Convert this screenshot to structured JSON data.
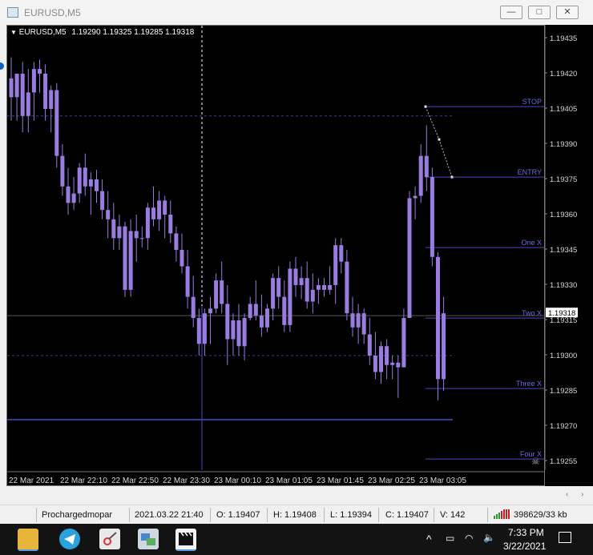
{
  "window": {
    "title": "EURUSD,M5",
    "buttons": {
      "minimize": "—",
      "maximize": "□",
      "close": "✕"
    }
  },
  "chart": {
    "header_symbol": "EURUSD,M5",
    "header_ohlc": "1.19290 1.19325 1.19285 1.19318",
    "price_ticks": [
      "1.19435",
      "1.19420",
      "1.19405",
      "1.19390",
      "1.19375",
      "1.19360",
      "1.19345",
      "1.19330",
      "1.19315",
      "1.19300",
      "1.19285",
      "1.19270",
      "1.19255"
    ],
    "current_price": "1.19318",
    "time_ticks": [
      "22 Mar 2021",
      "22 Mar 22:10",
      "22 Mar 22:50",
      "22 Mar 23:30",
      "23 Mar 00:10",
      "23 Mar 01:05",
      "23 Mar 01:45",
      "23 Mar 02:25",
      "23 Mar 03:05"
    ],
    "levels": [
      {
        "label": "STOP",
        "price": 1.19406
      },
      {
        "label": "ENTRY",
        "price": 1.19376
      },
      {
        "label": "One X",
        "price": 1.19346
      },
      {
        "label": "Two X",
        "price": 1.19316
      },
      {
        "label": "Three X",
        "price": 1.19286
      },
      {
        "label": "Four X",
        "price": 1.19256
      }
    ],
    "candles": [
      {
        "o": 1.19418,
        "h": 1.19427,
        "l": 1.194,
        "c": 1.1941
      },
      {
        "o": 1.1941,
        "h": 1.19418,
        "l": 1.194,
        "c": 1.1942
      },
      {
        "o": 1.1942,
        "h": 1.19425,
        "l": 1.19395,
        "c": 1.19402
      },
      {
        "o": 1.19402,
        "h": 1.19422,
        "l": 1.19395,
        "c": 1.19412
      },
      {
        "o": 1.19412,
        "h": 1.19425,
        "l": 1.194,
        "c": 1.19422
      },
      {
        "o": 1.19422,
        "h": 1.19426,
        "l": 1.19412,
        "c": 1.1942
      },
      {
        "o": 1.1942,
        "h": 1.19424,
        "l": 1.194,
        "c": 1.19405
      },
      {
        "o": 1.19405,
        "h": 1.19415,
        "l": 1.19395,
        "c": 1.19413
      },
      {
        "o": 1.19413,
        "h": 1.19416,
        "l": 1.1938,
        "c": 1.19385
      },
      {
        "o": 1.19385,
        "h": 1.1939,
        "l": 1.19368,
        "c": 1.19372
      },
      {
        "o": 1.19372,
        "h": 1.1938,
        "l": 1.1936,
        "c": 1.19365
      },
      {
        "o": 1.19365,
        "h": 1.19376,
        "l": 1.19362,
        "c": 1.19369
      },
      {
        "o": 1.19369,
        "h": 1.19382,
        "l": 1.19365,
        "c": 1.1938
      },
      {
        "o": 1.1938,
        "h": 1.19386,
        "l": 1.19368,
        "c": 1.19372
      },
      {
        "o": 1.19372,
        "h": 1.19378,
        "l": 1.1936,
        "c": 1.19375
      },
      {
        "o": 1.19375,
        "h": 1.19379,
        "l": 1.19365,
        "c": 1.1937
      },
      {
        "o": 1.1937,
        "h": 1.19375,
        "l": 1.19358,
        "c": 1.19362
      },
      {
        "o": 1.19362,
        "h": 1.1937,
        "l": 1.1935,
        "c": 1.19358
      },
      {
        "o": 1.19358,
        "h": 1.19365,
        "l": 1.19345,
        "c": 1.1935
      },
      {
        "o": 1.1935,
        "h": 1.1936,
        "l": 1.19345,
        "c": 1.19355
      },
      {
        "o": 1.19355,
        "h": 1.19357,
        "l": 1.19325,
        "c": 1.19328
      },
      {
        "o": 1.19328,
        "h": 1.19358,
        "l": 1.19325,
        "c": 1.19353
      },
      {
        "o": 1.19353,
        "h": 1.1936,
        "l": 1.1934,
        "c": 1.1935
      },
      {
        "o": 1.1935,
        "h": 1.19355,
        "l": 1.19346,
        "c": 1.1935
      },
      {
        "o": 1.1935,
        "h": 1.19365,
        "l": 1.19345,
        "c": 1.19363
      },
      {
        "o": 1.19363,
        "h": 1.19372,
        "l": 1.19355,
        "c": 1.19358
      },
      {
        "o": 1.19358,
        "h": 1.1937,
        "l": 1.19353,
        "c": 1.19366
      },
      {
        "o": 1.19366,
        "h": 1.19368,
        "l": 1.1935,
        "c": 1.1936
      },
      {
        "o": 1.1936,
        "h": 1.19366,
        "l": 1.19348,
        "c": 1.19352
      },
      {
        "o": 1.19352,
        "h": 1.19355,
        "l": 1.1934,
        "c": 1.19345
      },
      {
        "o": 1.19345,
        "h": 1.19352,
        "l": 1.19335,
        "c": 1.19338
      },
      {
        "o": 1.19338,
        "h": 1.19345,
        "l": 1.1932,
        "c": 1.19325
      },
      {
        "o": 1.19325,
        "h": 1.19334,
        "l": 1.19312,
        "c": 1.19316
      },
      {
        "o": 1.19316,
        "h": 1.1932,
        "l": 1.193,
        "c": 1.19305
      },
      {
        "o": 1.19305,
        "h": 1.1932,
        "l": 1.193,
        "c": 1.19318
      },
      {
        "o": 1.19318,
        "h": 1.19325,
        "l": 1.19305,
        "c": 1.1932
      },
      {
        "o": 1.1932,
        "h": 1.19335,
        "l": 1.19318,
        "c": 1.19332
      },
      {
        "o": 1.19332,
        "h": 1.1934,
        "l": 1.19318,
        "c": 1.19322
      },
      {
        "o": 1.19322,
        "h": 1.1933,
        "l": 1.19296,
        "c": 1.19307
      },
      {
        "o": 1.19307,
        "h": 1.19318,
        "l": 1.193,
        "c": 1.19315
      },
      {
        "o": 1.19315,
        "h": 1.19322,
        "l": 1.193,
        "c": 1.19304
      },
      {
        "o": 1.19304,
        "h": 1.19318,
        "l": 1.19298,
        "c": 1.19316
      },
      {
        "o": 1.19316,
        "h": 1.19325,
        "l": 1.19315,
        "c": 1.19322
      },
      {
        "o": 1.19322,
        "h": 1.19332,
        "l": 1.19315,
        "c": 1.19317
      },
      {
        "o": 1.19317,
        "h": 1.19326,
        "l": 1.19308,
        "c": 1.19312
      },
      {
        "o": 1.19312,
        "h": 1.19322,
        "l": 1.1931,
        "c": 1.1932
      },
      {
        "o": 1.1932,
        "h": 1.19335,
        "l": 1.19315,
        "c": 1.19333
      },
      {
        "o": 1.19333,
        "h": 1.19338,
        "l": 1.1932,
        "c": 1.19325
      },
      {
        "o": 1.19325,
        "h": 1.19332,
        "l": 1.1931,
        "c": 1.19313
      },
      {
        "o": 1.19313,
        "h": 1.1934,
        "l": 1.1931,
        "c": 1.19337
      },
      {
        "o": 1.19337,
        "h": 1.19342,
        "l": 1.19325,
        "c": 1.1933
      },
      {
        "o": 1.1933,
        "h": 1.19338,
        "l": 1.19324,
        "c": 1.19333
      },
      {
        "o": 1.19333,
        "h": 1.1934,
        "l": 1.1932,
        "c": 1.19323
      },
      {
        "o": 1.19323,
        "h": 1.19335,
        "l": 1.19318,
        "c": 1.19328
      },
      {
        "o": 1.19328,
        "h": 1.19333,
        "l": 1.19322,
        "c": 1.1933
      },
      {
        "o": 1.1933,
        "h": 1.19333,
        "l": 1.19325,
        "c": 1.19328
      },
      {
        "o": 1.19328,
        "h": 1.19338,
        "l": 1.19326,
        "c": 1.1933
      },
      {
        "o": 1.1933,
        "h": 1.1935,
        "l": 1.19322,
        "c": 1.19347
      },
      {
        "o": 1.19347,
        "h": 1.1935,
        "l": 1.19335,
        "c": 1.1934
      },
      {
        "o": 1.1934,
        "h": 1.19345,
        "l": 1.19315,
        "c": 1.19318
      },
      {
        "o": 1.19318,
        "h": 1.19325,
        "l": 1.19308,
        "c": 1.19312
      },
      {
        "o": 1.19312,
        "h": 1.19322,
        "l": 1.19305,
        "c": 1.19318
      },
      {
        "o": 1.19318,
        "h": 1.1932,
        "l": 1.19305,
        "c": 1.19309
      },
      {
        "o": 1.19309,
        "h": 1.19316,
        "l": 1.19296,
        "c": 1.193
      },
      {
        "o": 1.193,
        "h": 1.1931,
        "l": 1.1929,
        "c": 1.19293
      },
      {
        "o": 1.19293,
        "h": 1.19306,
        "l": 1.19288,
        "c": 1.19304
      },
      {
        "o": 1.19304,
        "h": 1.19307,
        "l": 1.1929,
        "c": 1.19296
      },
      {
        "o": 1.19296,
        "h": 1.193,
        "l": 1.1929,
        "c": 1.19297
      },
      {
        "o": 1.19297,
        "h": 1.193,
        "l": 1.19282,
        "c": 1.19295
      },
      {
        "o": 1.19295,
        "h": 1.1932,
        "l": 1.19295,
        "c": 1.19316
      },
      {
        "o": 1.19316,
        "h": 1.1937,
        "l": 1.19316,
        "c": 1.19367
      },
      {
        "o": 1.19367,
        "h": 1.19372,
        "l": 1.19358,
        "c": 1.19368
      },
      {
        "o": 1.19368,
        "h": 1.1939,
        "l": 1.19365,
        "c": 1.19385
      },
      {
        "o": 1.19385,
        "h": 1.19398,
        "l": 1.1937,
        "c": 1.19376
      },
      {
        "o": 1.19376,
        "h": 1.1938,
        "l": 1.19338,
        "c": 1.19342
      },
      {
        "o": 1.19342,
        "h": 1.19344,
        "l": 1.19281,
        "c": 1.1929
      },
      {
        "o": 1.1929,
        "h": 1.19325,
        "l": 1.19285,
        "c": 1.19318
      }
    ]
  },
  "status": {
    "profile": "Prochargedmopar",
    "datetime": "2021.03.22 21:40",
    "open": "O: 1.19407",
    "high": "H: 1.19408",
    "low": "L: 1.19394",
    "close": "C: 1.19407",
    "volume": "V: 142",
    "traffic": "398629/33 kb"
  },
  "taskbar": {
    "time": "7:33 PM",
    "date": "3/22/2021"
  },
  "colors": {
    "candle": "#9a7ce0",
    "level_line": "#4a4ac8",
    "axis_text": "#d8d8d8"
  }
}
